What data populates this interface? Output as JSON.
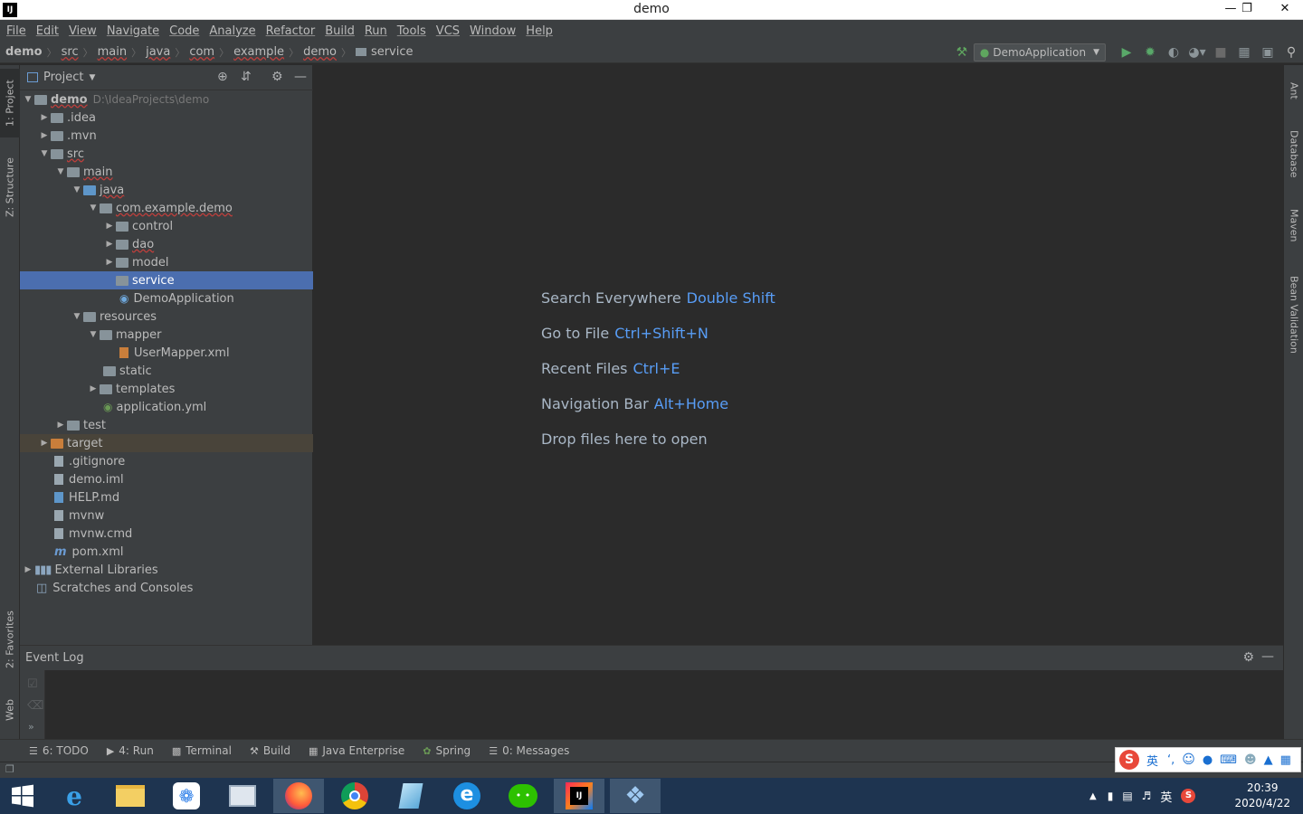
{
  "window": {
    "title": "demo"
  },
  "menu": [
    "File",
    "Edit",
    "View",
    "Navigate",
    "Code",
    "Analyze",
    "Refactor",
    "Build",
    "Run",
    "Tools",
    "VCS",
    "Window",
    "Help"
  ],
  "breadcrumb": {
    "root": "demo",
    "items": [
      "src",
      "main",
      "java",
      "com",
      "example",
      "demo"
    ],
    "current": "service"
  },
  "toolbar": {
    "run_config": "DemoApplication"
  },
  "left_tabs": {
    "project": "1: Project",
    "structure": "Z: Structure",
    "favorites": "2: Favorites",
    "web": "Web"
  },
  "right_tabs": {
    "ant": "Ant",
    "database": "Database",
    "maven": "Maven",
    "bean": "Bean Validation"
  },
  "project_panel": {
    "title": "Project"
  },
  "tree": [
    {
      "label": "demo",
      "hint": "D:\\IdeaProjects\\demo"
    },
    {
      "label": ".idea"
    },
    {
      "label": ".mvn"
    },
    {
      "label": "src"
    },
    {
      "label": "main"
    },
    {
      "label": "java"
    },
    {
      "label": "com.example.demo"
    },
    {
      "label": "control"
    },
    {
      "label": "dao"
    },
    {
      "label": "model"
    },
    {
      "label": "service"
    },
    {
      "label": "DemoApplication"
    },
    {
      "label": "resources"
    },
    {
      "label": "mapper"
    },
    {
      "label": "UserMapper.xml"
    },
    {
      "label": "static"
    },
    {
      "label": "templates"
    },
    {
      "label": "application.yml"
    },
    {
      "label": "test"
    },
    {
      "label": "target"
    },
    {
      "label": ".gitignore"
    },
    {
      "label": "demo.iml"
    },
    {
      "label": "HELP.md"
    },
    {
      "label": "mvnw"
    },
    {
      "label": "mvnw.cmd"
    },
    {
      "label": "pom.xml"
    },
    {
      "label": "External Libraries"
    },
    {
      "label": "Scratches and Consoles"
    }
  ],
  "editor_hints": [
    {
      "text": "Search Everywhere",
      "key": "Double Shift"
    },
    {
      "text": "Go to File",
      "key": "Ctrl+Shift+N"
    },
    {
      "text": "Recent Files",
      "key": "Ctrl+E"
    },
    {
      "text": "Navigation Bar",
      "key": "Alt+Home"
    },
    {
      "text": "Drop files here to open",
      "key": ""
    }
  ],
  "event_log": {
    "title": "Event Log"
  },
  "bottom_tabs": [
    "6: TODO",
    "4: Run",
    "Terminal",
    "Build",
    "Java Enterprise",
    "Spring",
    "0: Messages"
  ],
  "tray": {
    "ime_lang": "英",
    "time": "20:39",
    "date": "2020/4/22"
  }
}
